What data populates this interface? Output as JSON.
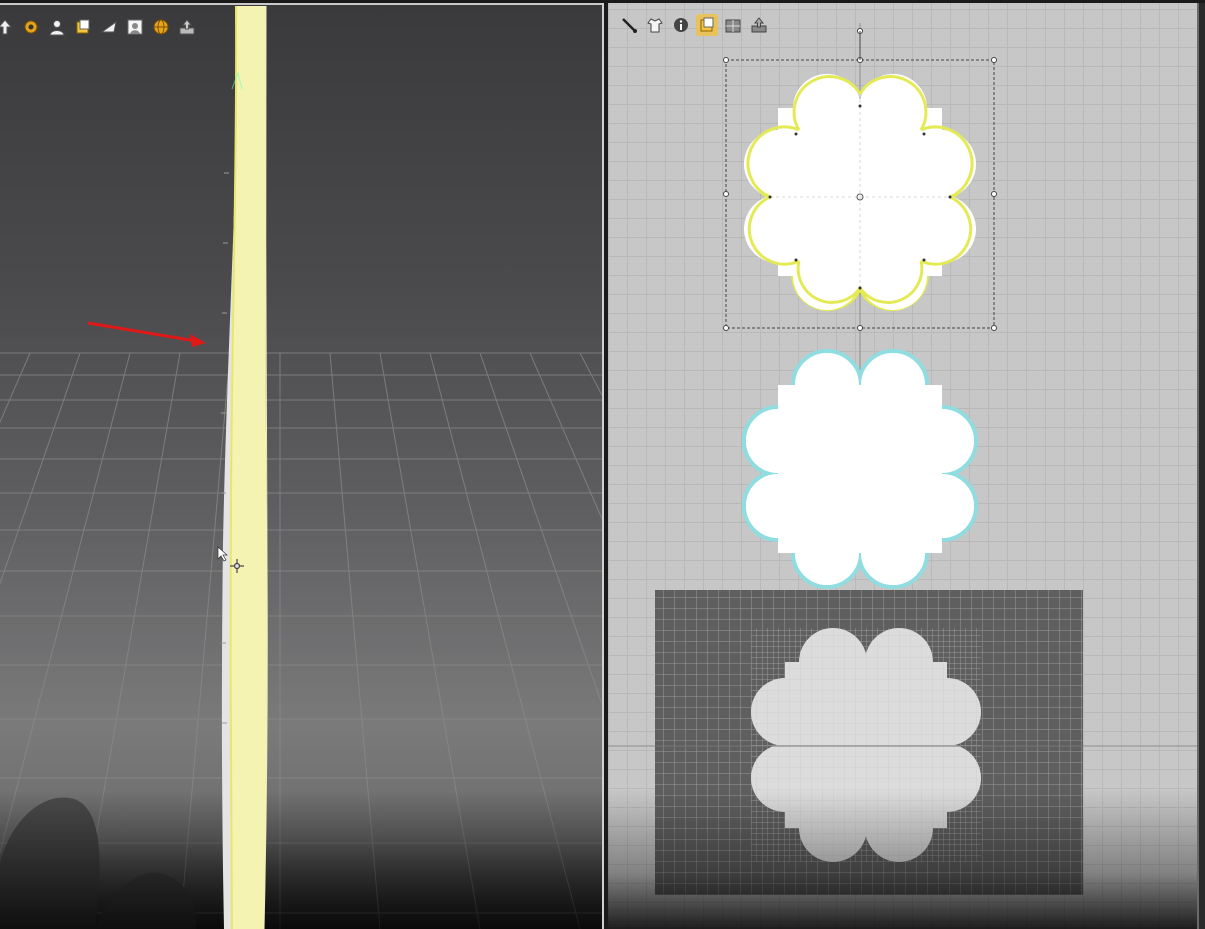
{
  "views": {
    "left": {
      "name": "3d-viewport"
    },
    "right": {
      "name": "2d-pattern-window"
    }
  },
  "left_toolbar": {
    "icons": [
      "arrow-up-icon",
      "gear-icon",
      "avatar-icon",
      "sheet-icon",
      "plane-icon",
      "person-icon",
      "globe-icon",
      "export-icon"
    ]
  },
  "right_toolbar": {
    "icons": [
      "brush-icon",
      "shirt-icon",
      "info-icon",
      "sheet-icon",
      "grid-icon",
      "export-icon"
    ],
    "active_index": 3
  },
  "colors": {
    "selected_outline": "#e6ec4a",
    "secondary_outline": "#8fdde0",
    "fabric_yellow": "#f5f3b2",
    "annotation_arrow": "#e01818"
  }
}
